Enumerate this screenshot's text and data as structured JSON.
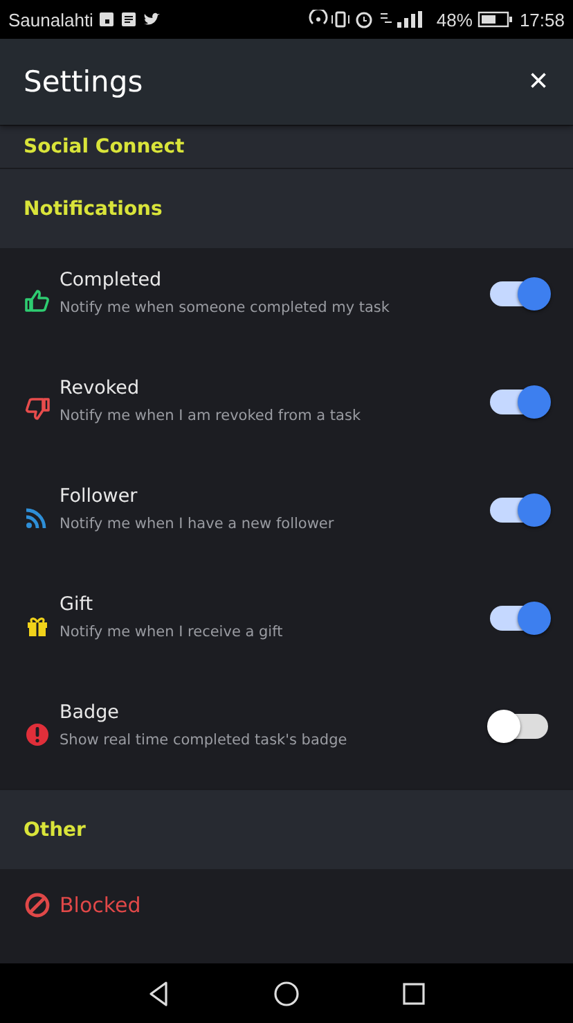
{
  "status_bar": {
    "carrier": "Saunalahti",
    "battery": "48%",
    "time": "17:58"
  },
  "header": {
    "title": "Settings",
    "close": "×"
  },
  "sections": [
    {
      "title": "Social Connect"
    },
    {
      "title": "Notifications",
      "items": [
        {
          "kind": "thumbs-up",
          "title": "Completed",
          "description": "Notify me when someone completed my task",
          "on": true
        },
        {
          "kind": "thumbs-down",
          "title": "Revoked",
          "description": "Notify me when I am revoked from a task",
          "on": true
        },
        {
          "kind": "rss",
          "title": "Follower",
          "description": "Notify me when I have a new follower",
          "on": true
        },
        {
          "kind": "gift",
          "title": "Gift",
          "description": "Notify me when I receive a gift",
          "on": true
        },
        {
          "kind": "alert",
          "title": "Badge",
          "description": "Show real time completed task's badge",
          "on": false
        }
      ]
    },
    {
      "title": "Other",
      "items": [
        {
          "kind": "blocked",
          "title": "Blocked"
        }
      ]
    }
  ]
}
